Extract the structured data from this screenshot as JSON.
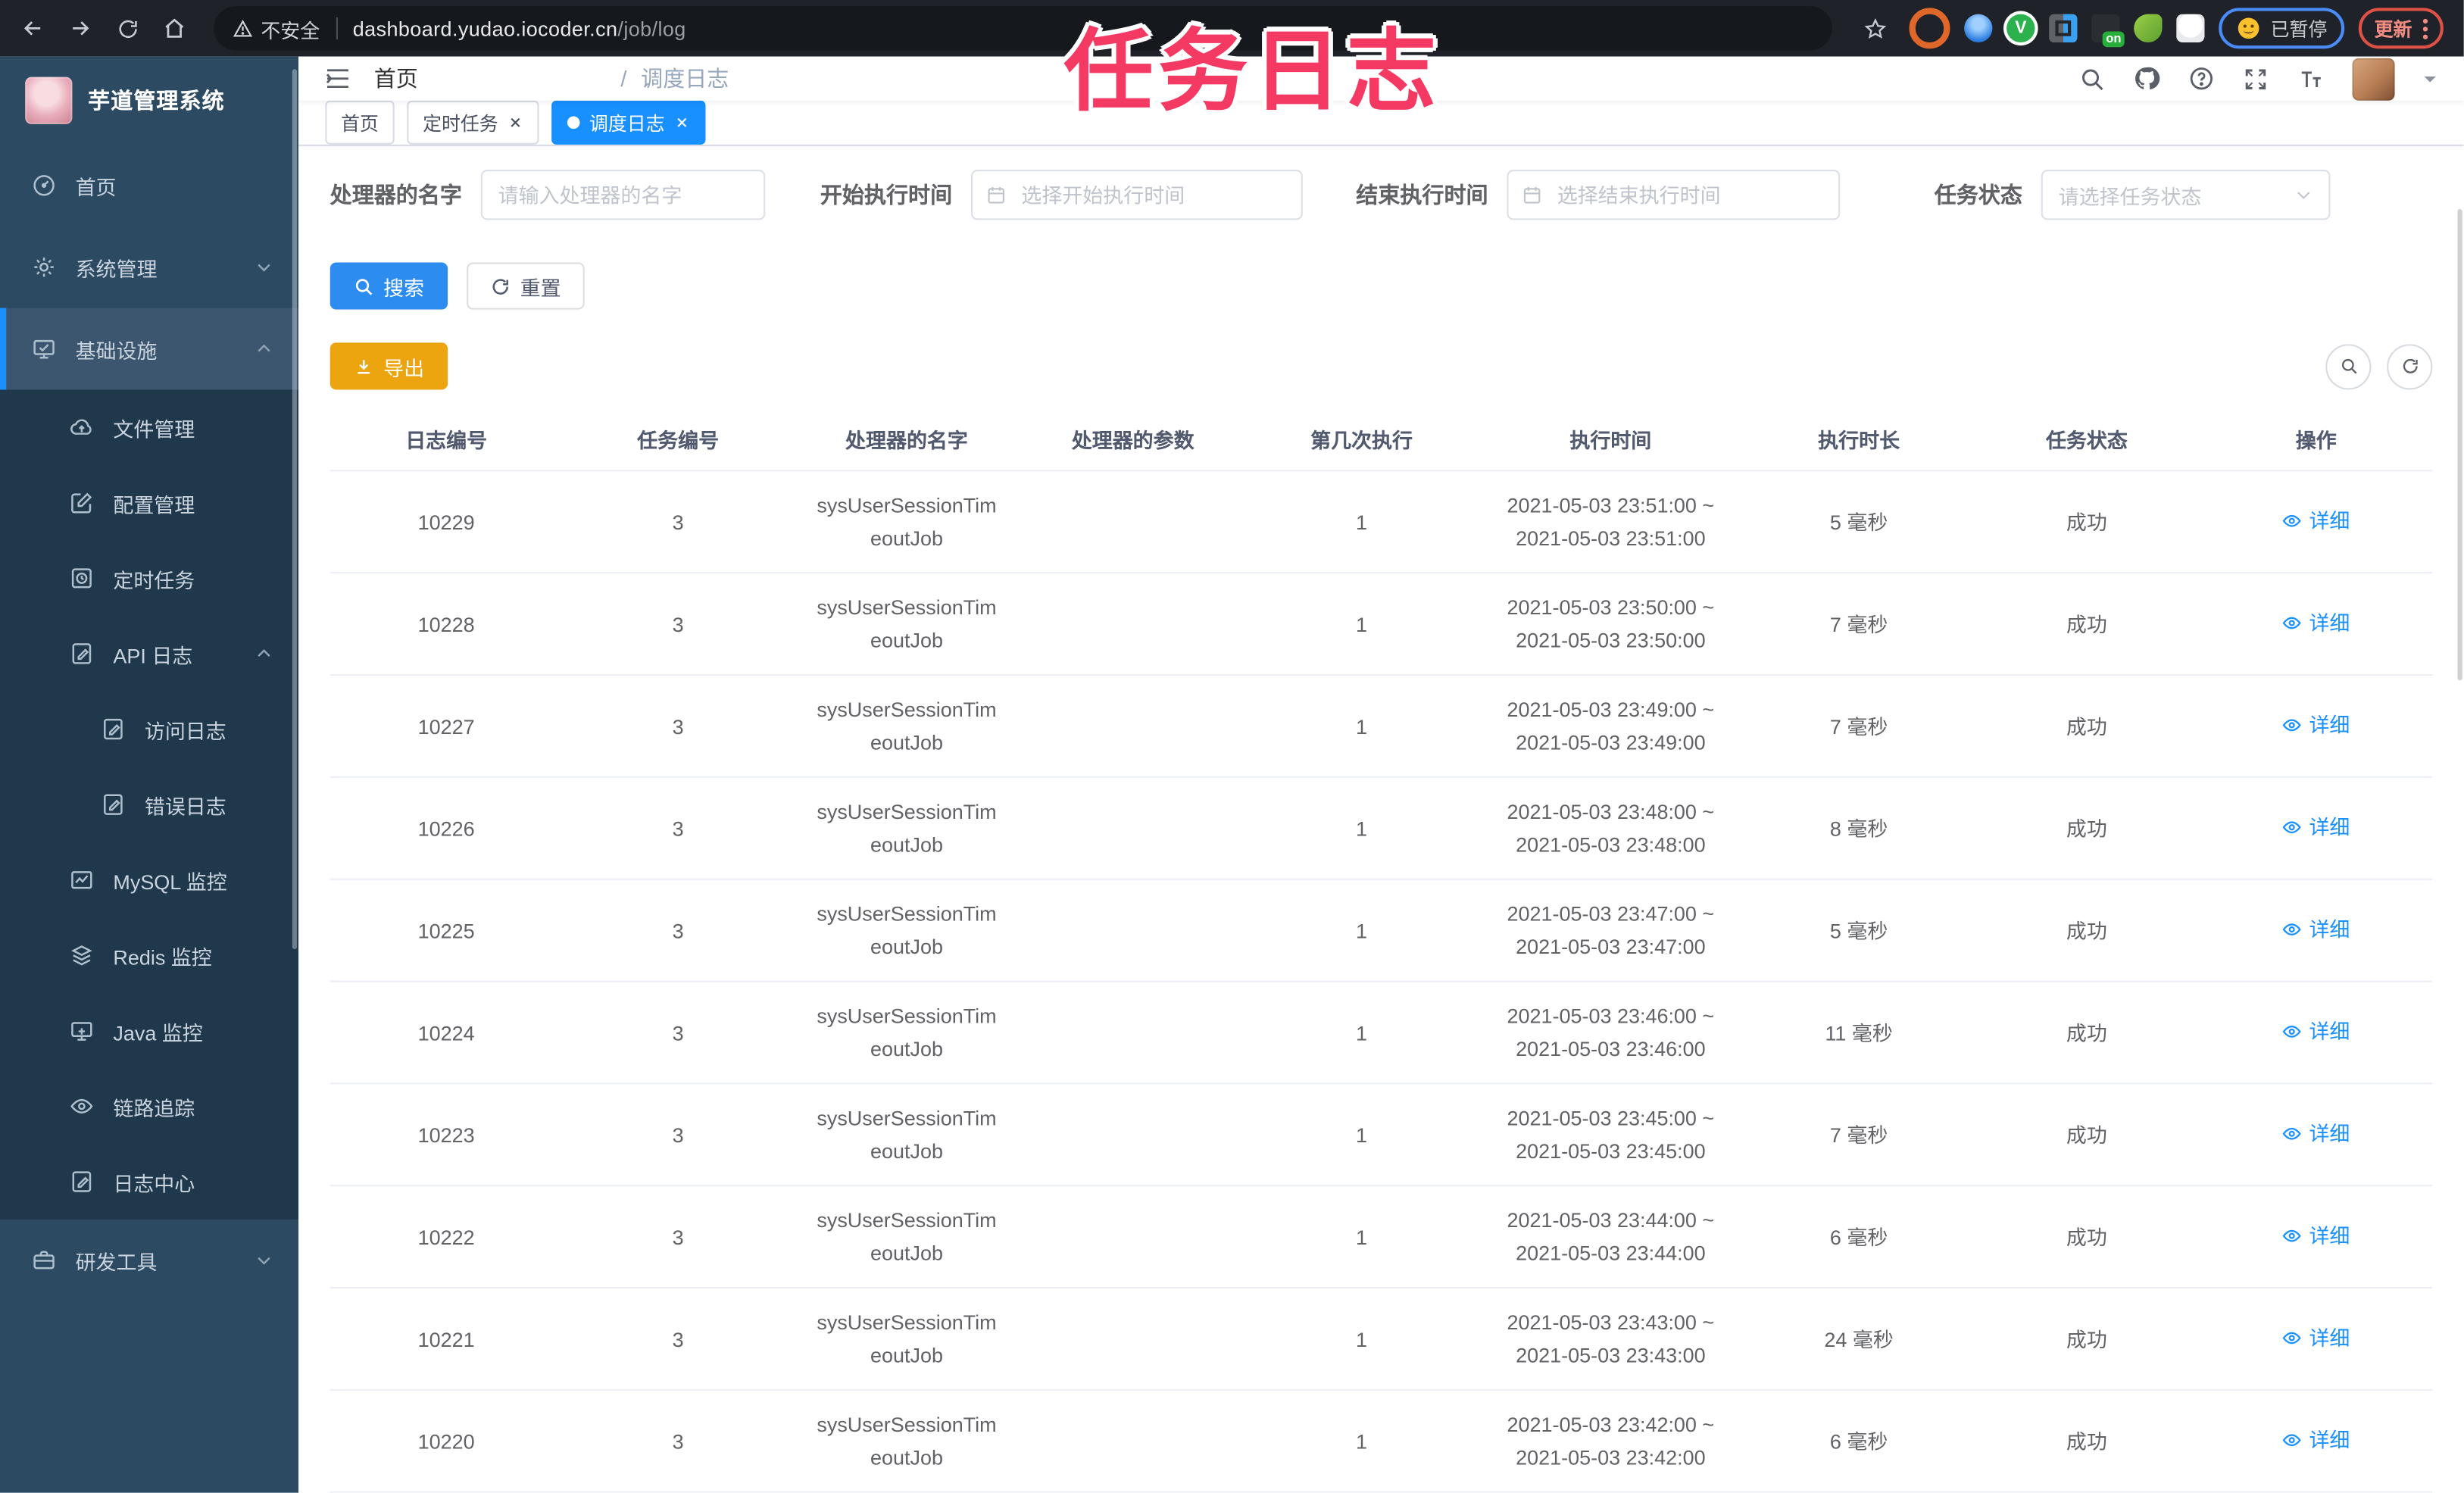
{
  "overlay": {
    "title": "任务日志"
  },
  "browser": {
    "security_label": "不安全",
    "url_host": "dashboard.yudao.iocoder.cn",
    "url_path": "/job/log",
    "ext_v_badge": "V",
    "ext_on_badge": "on",
    "paused_chip": "已暂停",
    "update_button": "更新"
  },
  "sidebar": {
    "app_title": "芋道管理系统",
    "items": [
      {
        "label": "首页"
      },
      {
        "label": "系统管理"
      },
      {
        "label": "基础设施"
      },
      {
        "label": "文件管理"
      },
      {
        "label": "配置管理"
      },
      {
        "label": "定时任务"
      },
      {
        "label": "API 日志"
      },
      {
        "label": "访问日志"
      },
      {
        "label": "错误日志"
      },
      {
        "label": "MySQL 监控"
      },
      {
        "label": "Redis 监控"
      },
      {
        "label": "Java 监控"
      },
      {
        "label": "链路追踪"
      },
      {
        "label": "日志中心"
      },
      {
        "label": "研发工具"
      }
    ]
  },
  "navbar": {
    "breadcrumb": {
      "home": "首页",
      "separator": "/",
      "current": "调度日志"
    }
  },
  "tabs": [
    {
      "label": "首页",
      "closable": false,
      "active": false
    },
    {
      "label": "定时任务",
      "closable": true,
      "active": false
    },
    {
      "label": "调度日志",
      "closable": true,
      "active": true
    }
  ],
  "filters": {
    "handler": {
      "label": "处理器的名字",
      "placeholder": "请输入处理器的名字"
    },
    "begin_time": {
      "label": "开始执行时间",
      "placeholder": "选择开始执行时间"
    },
    "end_time": {
      "label": "结束执行时间",
      "placeholder": "选择结束执行时间"
    },
    "status": {
      "label": "任务状态",
      "placeholder": "请选择任务状态"
    }
  },
  "toolbar": {
    "search_label": "搜索",
    "reset_label": "重置",
    "export_label": "导出"
  },
  "table": {
    "headers": [
      "日志编号",
      "任务编号",
      "处理器的名字",
      "处理器的参数",
      "第几次执行",
      "执行时间",
      "执行时长",
      "任务状态",
      "操作"
    ],
    "action_label": "详细",
    "rows": [
      {
        "log_id": "10229",
        "job_id": "3",
        "handler_line1": "sysUserSessionTim",
        "handler_line2": "eoutJob",
        "param": "",
        "execute_index": "1",
        "time_start": "2021-05-03 23:51:00 ~",
        "time_end": "2021-05-03 23:51:00",
        "duration": "5 毫秒",
        "status": "成功",
        "action": "详细"
      },
      {
        "log_id": "10228",
        "job_id": "3",
        "handler_line1": "sysUserSessionTim",
        "handler_line2": "eoutJob",
        "param": "",
        "execute_index": "1",
        "time_start": "2021-05-03 23:50:00 ~",
        "time_end": "2021-05-03 23:50:00",
        "duration": "7 毫秒",
        "status": "成功",
        "action": "详细"
      },
      {
        "log_id": "10227",
        "job_id": "3",
        "handler_line1": "sysUserSessionTim",
        "handler_line2": "eoutJob",
        "param": "",
        "execute_index": "1",
        "time_start": "2021-05-03 23:49:00 ~",
        "time_end": "2021-05-03 23:49:00",
        "duration": "7 毫秒",
        "status": "成功",
        "action": "详细"
      },
      {
        "log_id": "10226",
        "job_id": "3",
        "handler_line1": "sysUserSessionTim",
        "handler_line2": "eoutJob",
        "param": "",
        "execute_index": "1",
        "time_start": "2021-05-03 23:48:00 ~",
        "time_end": "2021-05-03 23:48:00",
        "duration": "8 毫秒",
        "status": "成功",
        "action": "详细"
      },
      {
        "log_id": "10225",
        "job_id": "3",
        "handler_line1": "sysUserSessionTim",
        "handler_line2": "eoutJob",
        "param": "",
        "execute_index": "1",
        "time_start": "2021-05-03 23:47:00 ~",
        "time_end": "2021-05-03 23:47:00",
        "duration": "5 毫秒",
        "status": "成功",
        "action": "详细"
      },
      {
        "log_id": "10224",
        "job_id": "3",
        "handler_line1": "sysUserSessionTim",
        "handler_line2": "eoutJob",
        "param": "",
        "execute_index": "1",
        "time_start": "2021-05-03 23:46:00 ~",
        "time_end": "2021-05-03 23:46:00",
        "duration": "11 毫秒",
        "status": "成功",
        "action": "详细"
      },
      {
        "log_id": "10223",
        "job_id": "3",
        "handler_line1": "sysUserSessionTim",
        "handler_line2": "eoutJob",
        "param": "",
        "execute_index": "1",
        "time_start": "2021-05-03 23:45:00 ~",
        "time_end": "2021-05-03 23:45:00",
        "duration": "7 毫秒",
        "status": "成功",
        "action": "详细"
      },
      {
        "log_id": "10222",
        "job_id": "3",
        "handler_line1": "sysUserSessionTim",
        "handler_line2": "eoutJob",
        "param": "",
        "execute_index": "1",
        "time_start": "2021-05-03 23:44:00 ~",
        "time_end": "2021-05-03 23:44:00",
        "duration": "6 毫秒",
        "status": "成功",
        "action": "详细"
      },
      {
        "log_id": "10221",
        "job_id": "3",
        "handler_line1": "sysUserSessionTim",
        "handler_line2": "eoutJob",
        "param": "",
        "execute_index": "1",
        "time_start": "2021-05-03 23:43:00 ~",
        "time_end": "2021-05-03 23:43:00",
        "duration": "24 毫秒",
        "status": "成功",
        "action": "详细"
      },
      {
        "log_id": "10220",
        "job_id": "3",
        "handler_line1": "sysUserSessionTim",
        "handler_line2": "eoutJob",
        "param": "",
        "execute_index": "1",
        "time_start": "2021-05-03 23:42:00 ~",
        "time_end": "2021-05-03 23:42:00",
        "duration": "6 毫秒",
        "status": "成功",
        "action": "详细"
      }
    ]
  }
}
